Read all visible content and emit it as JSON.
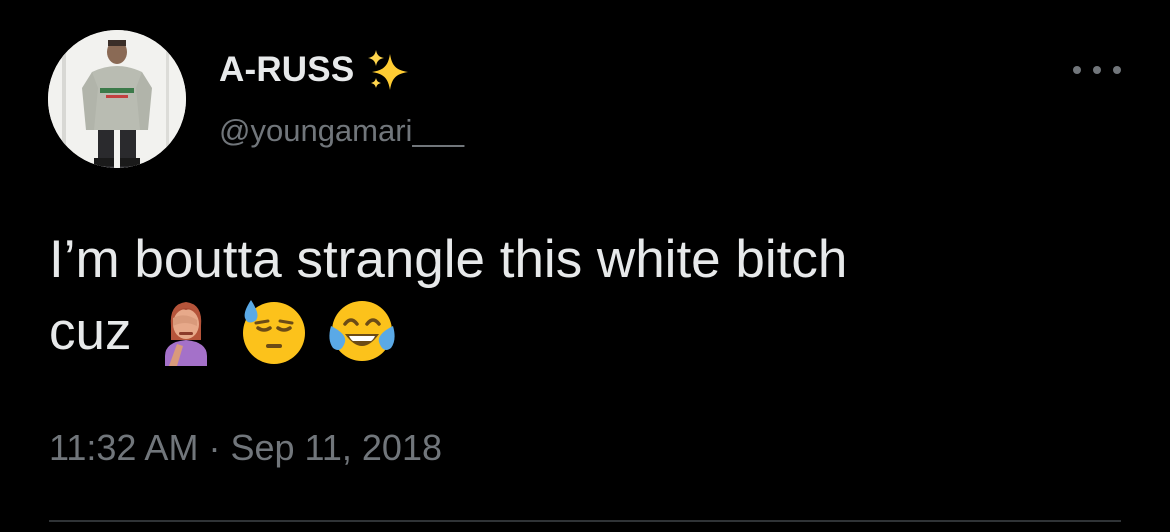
{
  "author": {
    "display_name": "A-RUSS",
    "handle": "@youngamari___",
    "name_emoji": "sparkles-icon"
  },
  "tweet": {
    "line1": "I’m boutta strangle this white bitch",
    "line2": "cuz",
    "emojis": [
      "woman-facepalming-emoji",
      "downcast-face-with-sweat-emoji",
      "face-with-tears-of-joy-emoji"
    ]
  },
  "meta": {
    "time": "11:32 AM",
    "separator": "·",
    "date": "Sep 11, 2018"
  },
  "colors": {
    "background": "#000000",
    "primary_text": "#e7e9ea",
    "secondary_text": "#71767b",
    "divider": "#2f3336"
  }
}
